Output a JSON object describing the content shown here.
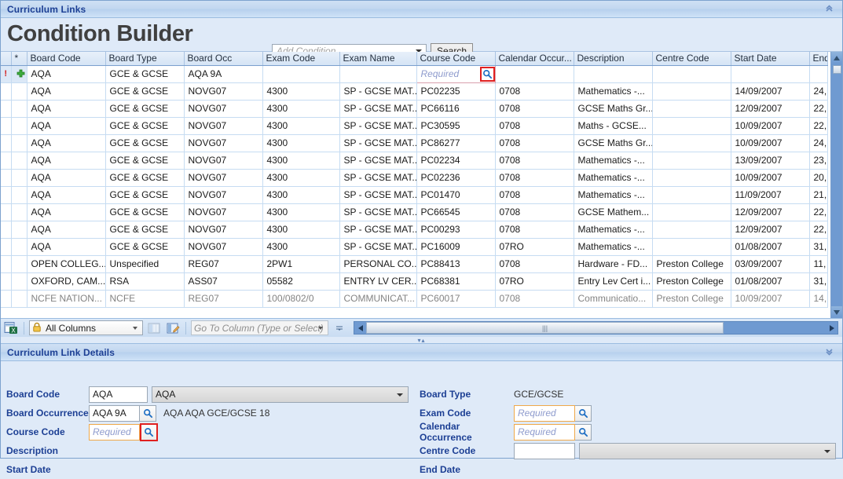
{
  "top_panel": {
    "title": "Curriculum Links",
    "collapse_icon": "chevron-up-double-icon"
  },
  "header": {
    "page_title": "Condition Builder",
    "condition_placeholder": "Add Condition",
    "condition_value": "",
    "search_label": "Search"
  },
  "grid": {
    "columns": [
      {
        "key": "ind",
        "label": ""
      },
      {
        "key": "star",
        "label": "*"
      },
      {
        "key": "board_code",
        "label": "Board Code"
      },
      {
        "key": "board_type",
        "label": "Board Type"
      },
      {
        "key": "board_occ",
        "label": "Board Occ"
      },
      {
        "key": "exam_code",
        "label": "Exam Code"
      },
      {
        "key": "exam_name",
        "label": "Exam Name"
      },
      {
        "key": "course_code",
        "label": "Course  Code"
      },
      {
        "key": "calendar_occ",
        "label": "Calendar Occur..."
      },
      {
        "key": "description",
        "label": "Description"
      },
      {
        "key": "centre_code",
        "label": "Centre Code"
      },
      {
        "key": "start_date",
        "label": "Start Date"
      },
      {
        "key": "end_date",
        "label": "End"
      }
    ],
    "new_row": {
      "indicator": "!",
      "add_icon": "add-plus-icon",
      "board_code": "AQA",
      "board_type": "GCE & GCSE",
      "board_occ": "AQA 9A",
      "exam_code": "",
      "exam_name": "",
      "course_code_placeholder": "Required",
      "course_code_value": "",
      "lookup_icon": "magnifier-icon",
      "calendar_occ": "",
      "description": "",
      "centre_code": "",
      "start_date": "",
      "end_date": ""
    },
    "rows": [
      [
        "AQA",
        "GCE & GCSE",
        "NOVG07",
        "4300",
        "SP - GCSE MAT...",
        "PC02235",
        "0708",
        "Mathematics -...",
        "",
        "14/09/2007",
        "24,"
      ],
      [
        "AQA",
        "GCE & GCSE",
        "NOVG07",
        "4300",
        "SP - GCSE MAT...",
        "PC66116",
        "0708",
        "GCSE Maths Gr...",
        "",
        "12/09/2007",
        "22,"
      ],
      [
        "AQA",
        "GCE & GCSE",
        "NOVG07",
        "4300",
        "SP - GCSE MAT...",
        "PC30595",
        "0708",
        "Maths - GCSE...",
        "",
        "10/09/2007",
        "22,"
      ],
      [
        "AQA",
        "GCE & GCSE",
        "NOVG07",
        "4300",
        "SP - GCSE MAT...",
        "PC86277",
        "0708",
        "GCSE Maths Gr...",
        "",
        "10/09/2007",
        "24,"
      ],
      [
        "AQA",
        "GCE & GCSE",
        "NOVG07",
        "4300",
        "SP - GCSE MAT...",
        "PC02234",
        "0708",
        "Mathematics -...",
        "",
        "13/09/2007",
        "23,"
      ],
      [
        "AQA",
        "GCE & GCSE",
        "NOVG07",
        "4300",
        "SP - GCSE MAT...",
        "PC02236",
        "0708",
        "Mathematics -...",
        "",
        "10/09/2007",
        "20,"
      ],
      [
        "AQA",
        "GCE & GCSE",
        "NOVG07",
        "4300",
        "SP - GCSE MAT...",
        "PC01470",
        "0708",
        "Mathematics -...",
        "",
        "11/09/2007",
        "21,"
      ],
      [
        "AQA",
        "GCE & GCSE",
        "NOVG07",
        "4300",
        "SP - GCSE MAT...",
        "PC66545",
        "0708",
        "GCSE Mathem...",
        "",
        "12/09/2007",
        "22,"
      ],
      [
        "AQA",
        "GCE & GCSE",
        "NOVG07",
        "4300",
        "SP - GCSE MAT...",
        "PC00293",
        "0708",
        "Mathematics -...",
        "",
        "12/09/2007",
        "22,"
      ],
      [
        "AQA",
        "GCE & GCSE",
        "NOVG07",
        "4300",
        "SP - GCSE MAT...",
        "PC16009",
        "07RO",
        "Mathematics -...",
        "",
        "01/08/2007",
        "31,"
      ],
      [
        "OPEN COLLEG...",
        "Unspecified",
        "REG07",
        "2PW1",
        "PERSONAL CO...",
        "PC88413",
        "0708",
        "Hardware - FD...",
        "Preston College",
        "03/09/2007",
        "11,"
      ],
      [
        "OXFORD, CAM...",
        "RSA",
        "ASS07",
        "05582",
        "ENTRY LV CER...",
        "PC68381",
        "07RO",
        "Entry Lev Cert i...",
        "Preston College",
        "01/08/2007",
        "31,"
      ],
      [
        "NCFE NATION...",
        "NCFE",
        "REG07",
        "100/0802/0",
        "COMMUNICAT...",
        "PC60017",
        "0708",
        "Communicatio...",
        "Preston College",
        "10/09/2007",
        "14,"
      ]
    ],
    "vscroll": {
      "up_icon": "scroll-up-arrow-icon",
      "down_icon": "scroll-down-arrow-icon"
    }
  },
  "grid_toolbar": {
    "export_icon": "export-excel-icon",
    "all_columns_label": "All Columns",
    "lock_icon": "lock-icon",
    "layout_icon": "column-layout-icon",
    "edit_layout_icon": "edit-layout-icon",
    "goto_placeholder": "Go To Column (Type or Select)",
    "goto_value": "",
    "hscroll_left_icon": "scroll-left-arrow-icon",
    "hscroll_right_icon": "scroll-right-arrow-icon",
    "hthumb_grip": "|||"
  },
  "details": {
    "title": "Curriculum Link Details",
    "expand_icon": "chevron-down-double-icon",
    "left": {
      "board_code_label": "Board Code",
      "board_code_value": "AQA",
      "board_code_desc": "AQA",
      "board_occurrence_label": "Board Occurrence",
      "board_occurrence_value": "AQA 9A",
      "board_occurrence_desc": "AQA AQA GCE/GCSE 18",
      "course_code_label": "Course  Code",
      "course_code_placeholder": "Required",
      "course_code_value": "",
      "description_label": "Description",
      "start_date_label": "Start Date"
    },
    "right": {
      "board_type_label": "Board Type",
      "board_type_value": "GCE/GCSE",
      "exam_code_label": "Exam Code",
      "exam_code_placeholder": "Required",
      "exam_code_value": "",
      "calendar_occurrence_label": "Calendar Occurrence",
      "calendar_occurrence_placeholder": "Required",
      "calendar_occurrence_value": "",
      "centre_code_label": "Centre Code",
      "centre_code_value": "",
      "centre_code_desc": "",
      "end_date_label": "End Date"
    },
    "lookup_icon": "magnifier-icon"
  },
  "colors": {
    "accent_blue": "#1c3f94",
    "new_row_green": "#a8e0ad",
    "required_pink": "#e0aab0",
    "readonly_blue": "#bcd3ec",
    "highlight_red": "#e02020",
    "required_border": "#efa94a"
  }
}
